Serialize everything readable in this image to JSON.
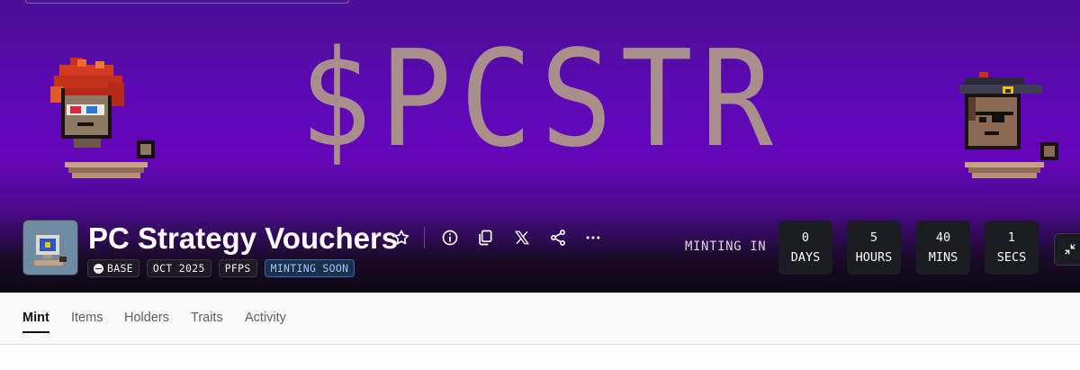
{
  "banner": {
    "ticker": "$PCSTR",
    "ticker_color": "#a98f8c",
    "background_color": "#6407b9"
  },
  "collection": {
    "name": "PC Strategy Vouchers",
    "avatar_icon": "pixel-computer-icon",
    "tags": {
      "chain": "BASE",
      "date": "OCT 2025",
      "category": "PFPS",
      "status": "MINTING SOON"
    },
    "actions": [
      "star-icon",
      "info-icon",
      "copy-icon",
      "x-logo-icon",
      "share-icon",
      "more-icon"
    ]
  },
  "countdown": {
    "label": "MINTING IN",
    "days_value": "0",
    "days_label": "DAYS",
    "hours_value": "5",
    "hours_label": "HOURS",
    "mins_value": "40",
    "mins_label": "MINS",
    "secs_value": "1",
    "secs_label": "SECS"
  },
  "tabs": {
    "mint": "Mint",
    "items": "Items",
    "holders": "Holders",
    "traits": "Traits",
    "activity": "Activity",
    "active": "Mint"
  },
  "colors": {
    "status_badge": "#9ec8ff",
    "tab_active": "#111111"
  }
}
